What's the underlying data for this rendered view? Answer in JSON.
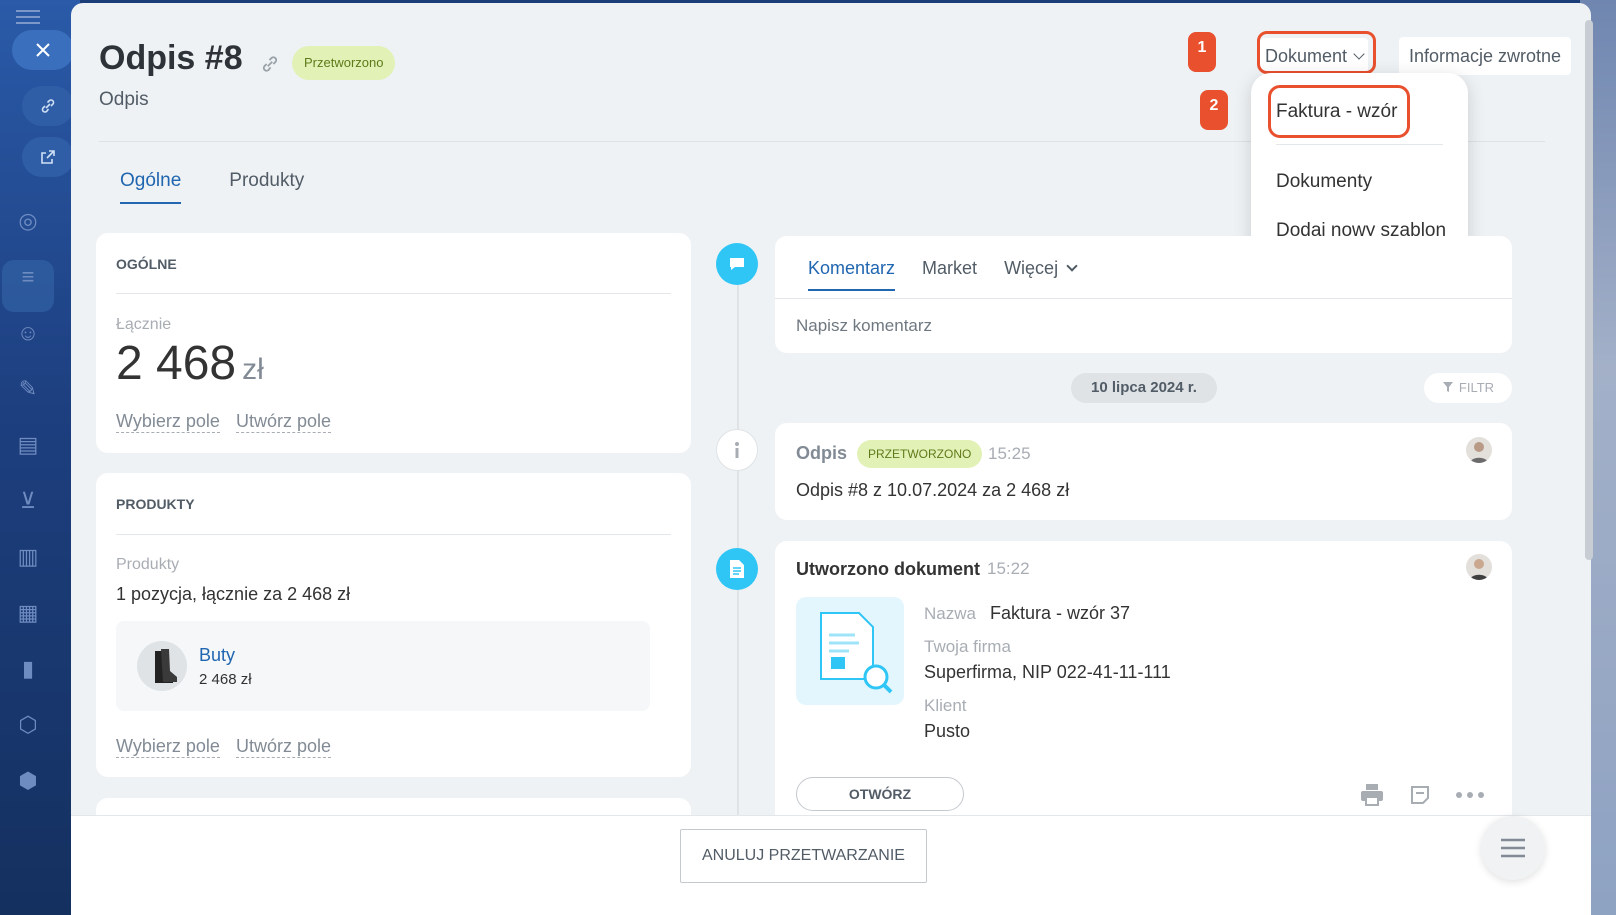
{
  "document": {
    "title": "Odpis #8",
    "status_badge": "Przetworzono",
    "subtitle": "Odpis"
  },
  "header": {
    "document_button": "Dokument",
    "feedback_button": "Informacje zwrotne"
  },
  "annotations": {
    "step1": "1",
    "step2": "2"
  },
  "document_menu": {
    "items": [
      "Faktura - wzór",
      "Dokumenty",
      "Dodaj nowy szablon"
    ]
  },
  "tabs": [
    "Ogólne",
    "Produkty"
  ],
  "general_card": {
    "heading": "OGÓLNE",
    "total_label": "Łącznie",
    "total_value": "2 468",
    "currency": "zł",
    "select_field": "Wybierz pole",
    "create_field": "Utwórz pole"
  },
  "products_card": {
    "heading": "PRODUKTY",
    "products_label": "Produkty",
    "summary": "1 pozycja, łącznie za 2 468 zł",
    "item_name": "Buty",
    "item_price": "2 468 zł",
    "select_field": "Wybierz pole",
    "create_field": "Utwórz pole"
  },
  "comment_box": {
    "tabs": [
      "Komentarz",
      "Market",
      "Więcej"
    ],
    "placeholder": "Napisz komentarz"
  },
  "timeline": {
    "date": "10 lipca 2024 r.",
    "filter": "FILTR",
    "entry1": {
      "title": "Odpis",
      "badge": "PRZETWORZONO",
      "time": "15:25",
      "text": "Odpis #8 z 10.07.2024 za 2 468 zł"
    },
    "entry2": {
      "title": "Utworzono dokument",
      "time": "15:22",
      "name_label": "Nazwa",
      "name_value": "Faktura - wzór 37",
      "company_label": "Twoja firma",
      "company_value": "Superfirma, NIP 022-41-11-111",
      "client_label": "Klient",
      "client_value": "Pusto",
      "open_button": "OTWÓRZ"
    }
  },
  "footer": {
    "cancel_button": "ANULUJ PRZETWARZANIE"
  },
  "colors": {
    "accent": "#2066b0",
    "highlight": "#e8502e",
    "status_green": "#e2f1b6",
    "timeline_blue": "#2fc6f6"
  }
}
